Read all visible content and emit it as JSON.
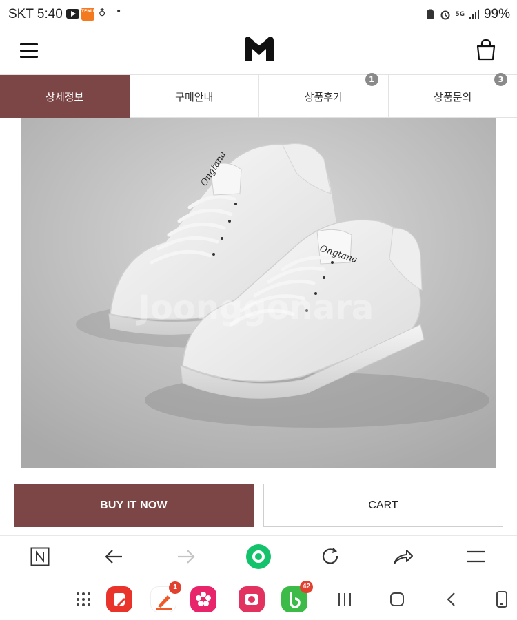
{
  "status_bar": {
    "carrier_time": "SKT 5:40",
    "temu_label": "TEMU",
    "network": "5G",
    "battery": "99%"
  },
  "header": {
    "logo_letter": "M"
  },
  "tabs": [
    {
      "label": "상세정보",
      "active": true,
      "badge": ""
    },
    {
      "label": "구매안내",
      "active": false,
      "badge": ""
    },
    {
      "label": "상품후기",
      "active": false,
      "badge": "1"
    },
    {
      "label": "상품문의",
      "active": false,
      "badge": "3"
    }
  ],
  "product": {
    "watermark": "Joonggonara",
    "shoe_brand_script": "Ongtana"
  },
  "actions": {
    "buy_now": "BUY IT NOW",
    "cart": "CART"
  },
  "dock": {
    "badge_one": "1",
    "badge_two": "42"
  },
  "colors": {
    "accent": "#7d4646",
    "badge_gray": "#8a8a8a",
    "browser_green": "#13c26b",
    "notif_red": "#e2412f"
  }
}
